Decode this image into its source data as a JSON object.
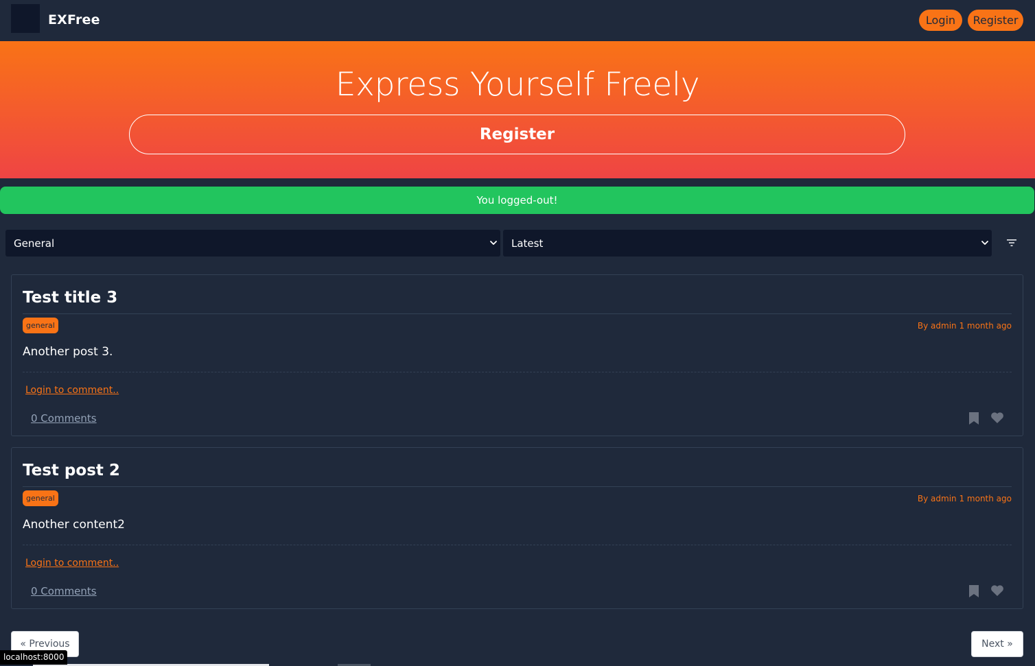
{
  "navbar": {
    "brand": "EXFree",
    "login_label": "Login",
    "register_label": "Register"
  },
  "hero": {
    "title": "Express Yourself Freely",
    "register_label": "Register"
  },
  "alert": {
    "message": "You logged-out!"
  },
  "filters": {
    "category_selected": "General",
    "sort_selected": "Latest"
  },
  "posts": [
    {
      "title": "Test title 3",
      "tag": "general",
      "meta": "By admin 1 month ago",
      "body": "Another post 3.",
      "login_prompt": "Login to comment..",
      "comments": "0 Comments"
    },
    {
      "title": "Test post 2",
      "tag": "general",
      "meta": "By admin 1 month ago",
      "body": "Another content2",
      "login_prompt": "Login to comment..",
      "comments": "0 Comments"
    }
  ],
  "pagination": {
    "prev_label": "« Previous",
    "next_label": "Next »"
  },
  "status_bar": {
    "url": "localhost:8000"
  },
  "colors": {
    "background": "#1f293b",
    "accent": "#f97316",
    "hero_gradient_end": "#ef4444",
    "success": "#22c55e",
    "input_bg": "#0f172a"
  }
}
